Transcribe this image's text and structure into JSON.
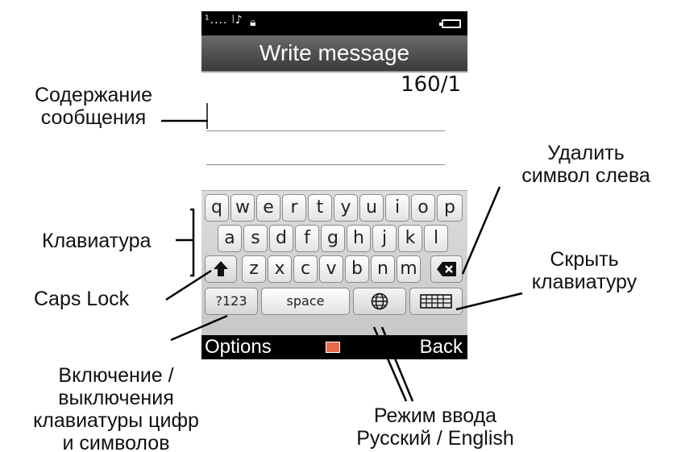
{
  "status": {
    "signal": "¹.... ⦚♪ ",
    "battery_icon": "battery-icon"
  },
  "screen": {
    "title": "Write message",
    "counter": "160/1"
  },
  "keyboard": {
    "row1": [
      "q",
      "w",
      "e",
      "r",
      "t",
      "y",
      "u",
      "i",
      "o",
      "p"
    ],
    "row2": [
      "a",
      "s",
      "d",
      "f",
      "g",
      "h",
      "j",
      "k",
      "l"
    ],
    "row3": [
      "z",
      "x",
      "c",
      "v",
      "b",
      "n",
      "m"
    ],
    "numbers_key": "?123",
    "space_key": "space"
  },
  "softkeys": {
    "left": "Options",
    "right": "Back"
  },
  "annotations": {
    "message_content": [
      "Содержание",
      "сообщения"
    ],
    "keyboard": "Клавиатура",
    "caps_lock": "Caps Lock",
    "numbers_toggle": [
      "Включение /",
      "выключения",
      "клавиатуры цифр",
      "и символов"
    ],
    "delete": [
      "Удалить",
      "символ слева"
    ],
    "hide_keyboard": [
      "Скрыть",
      "клавиатуру"
    ],
    "input_mode": [
      "Режим ввода",
      "Русский / English"
    ]
  }
}
